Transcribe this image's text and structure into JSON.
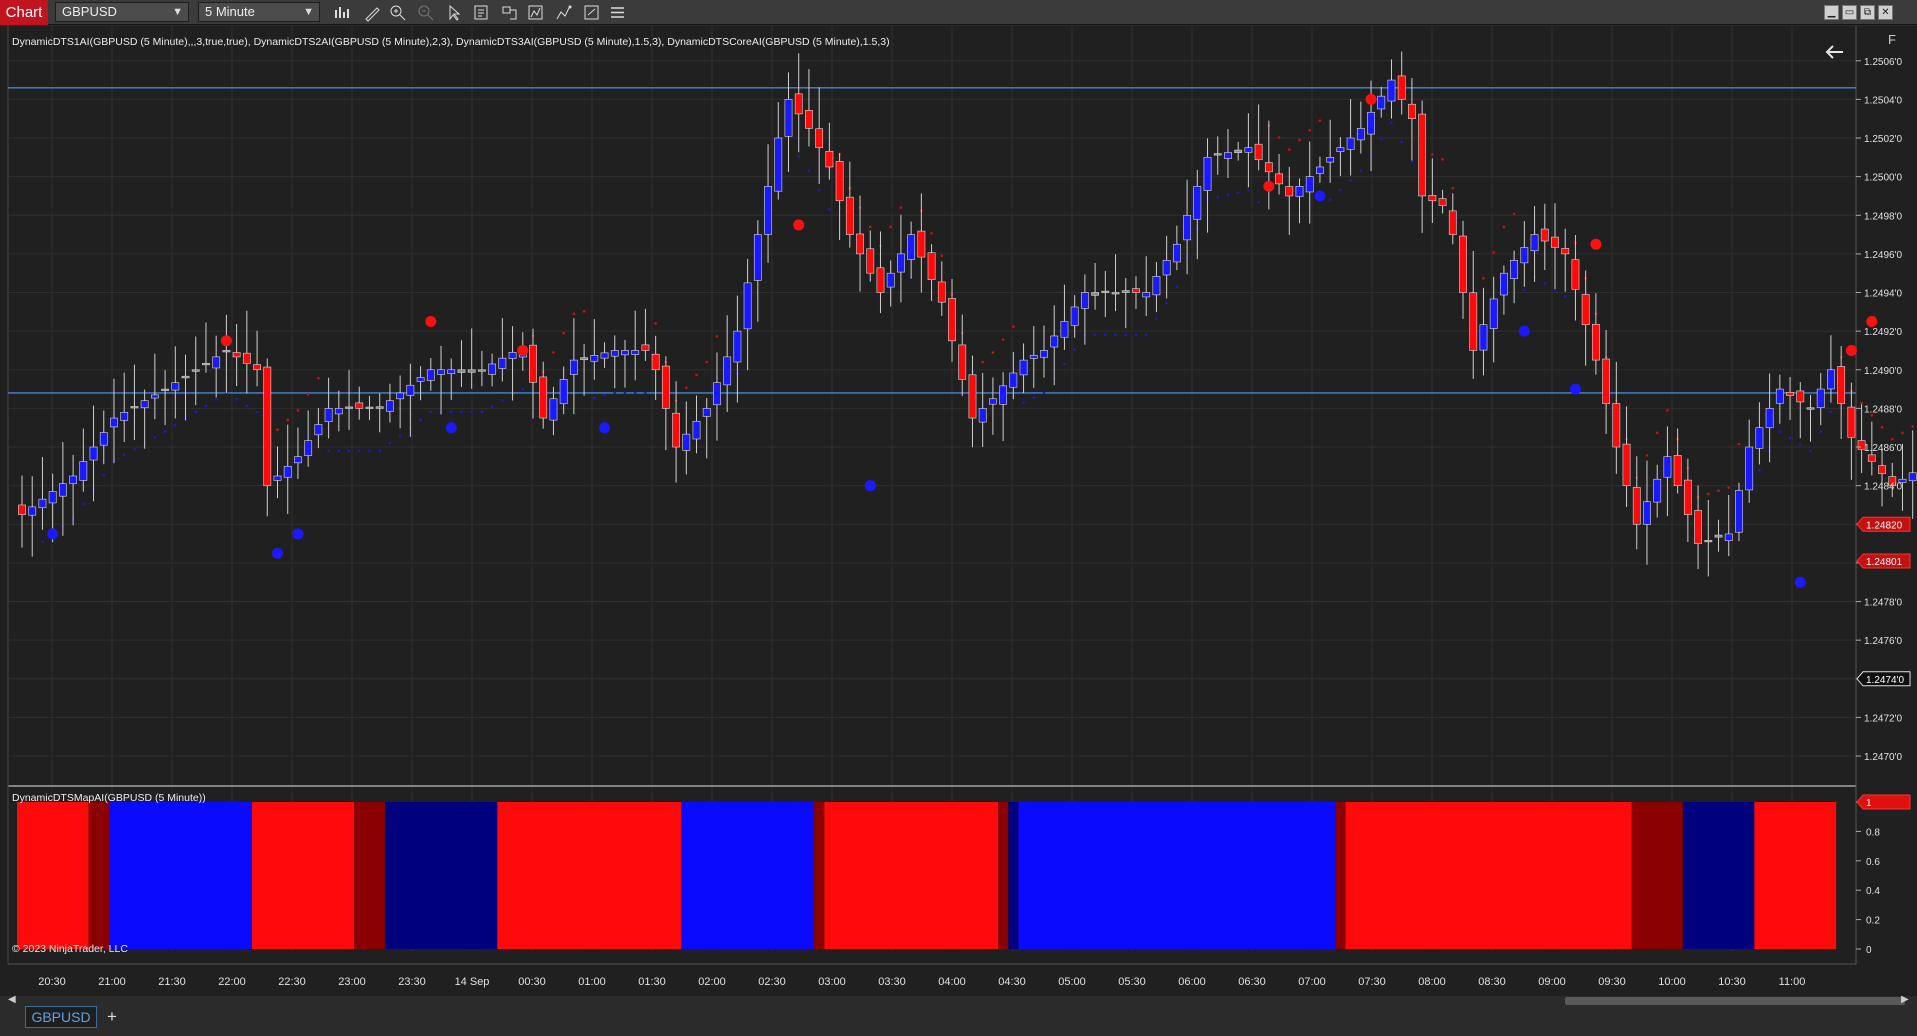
{
  "toolbar": {
    "tab_label": "Chart",
    "instrument": "GBPUSD",
    "interval": "5 Minute",
    "icons": [
      "bar-type-icon",
      "pencil-icon",
      "zoom-in-icon",
      "zoom-out-icon",
      "pointer-icon",
      "data-box-icon",
      "strategies-icon",
      "indicators-icon",
      "drawing-tools-icon",
      "properties-icon",
      "list-icon"
    ],
    "window_buttons": [
      "▁",
      "▭",
      "⧉",
      "✕"
    ]
  },
  "chart": {
    "indicator_label": "DynamicDTS1AI(GBPUSD (5 Minute),,,3,true,true), DynamicDTS2AI(GBPUSD (5 Minute),2,3), DynamicDTS3AI(GBPUSD (5 Minute),1.5,3), DynamicDTSCoreAI(GBPUSD (5 Minute),1.5,3)",
    "sub_panel_label": "DynamicDTSMapAI(GBPUSD (5 Minute))",
    "copyright": "© 2023 NinjaTrader, LLC",
    "f_button": "F",
    "colors": {
      "bull": "#1a1aff",
      "bear": "#ff0a0a",
      "neutral": "#8c8c8c",
      "line": "#4a82d6",
      "darkred": "#8b0000",
      "navy": "#00007f"
    }
  },
  "chart_data": {
    "type": "candlestick",
    "instrument": "GBPUSD",
    "interval": "5 Minute",
    "price_axis": [
      "1.2506'0",
      "1.2504'0",
      "1.2502'0",
      "1.2500'0",
      "1.2498'0",
      "1.2496'0",
      "1.2494'0",
      "1.2492'0",
      "1.2490'0",
      "1.2488'0",
      "1.2486'0",
      "1.2484'0",
      "1.2482'0",
      "1.2480'0",
      "1.2478'0",
      "1.2476'0",
      "1.2474'0",
      "1.2472'0",
      "1.2470'0"
    ],
    "price_values": [
      1.2506,
      1.2504,
      1.2502,
      1.25,
      1.2498,
      1.2496,
      1.2494,
      1.2492,
      1.249,
      1.2488,
      1.2486,
      1.2484,
      1.2482,
      1.248,
      1.2478,
      1.2476,
      1.2474,
      1.2472,
      1.247
    ],
    "ylim": [
      1.24685,
      1.25078
    ],
    "price_markers": [
      {
        "label": "1.24820",
        "value": 1.2482,
        "style": "filled-red"
      },
      {
        "label": "1.24801",
        "value": 1.24801,
        "style": "filled-red"
      },
      {
        "label": "1.2474'0",
        "value": 1.2474,
        "style": "outline"
      }
    ],
    "horizontal_lines": [
      1.25046,
      1.24888
    ],
    "time_axis": [
      "20:30",
      "21:00",
      "21:30",
      "22:00",
      "22:30",
      "23:00",
      "23:30",
      "14 Sep",
      "00:30",
      "01:00",
      "01:30",
      "02:00",
      "02:30",
      "03:00",
      "03:30",
      "04:00",
      "04:30",
      "05:00",
      "05:30",
      "06:00",
      "06:30",
      "07:00",
      "07:30",
      "08:00",
      "08:30",
      "09:00",
      "09:30",
      "10:00",
      "10:30",
      "11:00"
    ],
    "close_path": [
      [
        0,
        1.24825
      ],
      [
        5,
        1.24845
      ],
      [
        9,
        1.24875
      ],
      [
        14,
        1.2489
      ],
      [
        20,
        1.2491
      ],
      [
        23,
        1.249
      ],
      [
        24,
        1.2484
      ],
      [
        27,
        1.24855
      ],
      [
        30,
        1.2488
      ],
      [
        35,
        1.2488
      ],
      [
        40,
        1.249
      ],
      [
        45,
        1.249
      ],
      [
        49,
        1.24912
      ],
      [
        51,
        1.24875
      ],
      [
        54,
        1.24905
      ],
      [
        58,
        1.2491
      ],
      [
        61,
        1.2491
      ],
      [
        62,
        1.249
      ],
      [
        64,
        1.2486
      ],
      [
        67,
        1.2488
      ],
      [
        70,
        1.2492
      ],
      [
        72,
        1.2497
      ],
      [
        74,
        1.2502
      ],
      [
        75,
        1.2504
      ],
      [
        77,
        1.25025
      ],
      [
        79,
        1.25005
      ],
      [
        81,
        1.2497
      ],
      [
        84,
        1.2494
      ],
      [
        87,
        1.2497
      ],
      [
        90,
        1.24935
      ],
      [
        93,
        1.24875
      ],
      [
        95,
        1.24885
      ],
      [
        98,
        1.24905
      ],
      [
        100,
        1.2491
      ],
      [
        104,
        1.2494
      ],
      [
        110,
        1.2494
      ],
      [
        113,
        1.24965
      ],
      [
        116,
        1.2501
      ],
      [
        120,
        1.25015
      ],
      [
        124,
        1.2499
      ],
      [
        128,
        1.2501
      ],
      [
        131,
        1.25025
      ],
      [
        134,
        1.2505
      ],
      [
        136,
        1.2503
      ],
      [
        137,
        1.2499
      ],
      [
        139,
        1.24985
      ],
      [
        140,
        1.2497
      ],
      [
        142,
        1.2491
      ],
      [
        145,
        1.2495
      ],
      [
        148,
        1.2497
      ],
      [
        151,
        1.2496
      ],
      [
        154,
        1.24905
      ],
      [
        156,
        1.2486
      ],
      [
        158,
        1.2482
      ],
      [
        161,
        1.24855
      ],
      [
        164,
        1.2481
      ],
      [
        167,
        1.24815
      ],
      [
        169,
        1.2486
      ],
      [
        172,
        1.2489
      ],
      [
        175,
        1.2488
      ],
      [
        177,
        1.249
      ],
      [
        179,
        1.24865
      ],
      [
        183,
        1.2484
      ],
      [
        186,
        1.2485
      ],
      [
        188,
        1.2482
      ],
      [
        191,
        1.2479
      ],
      [
        193,
        1.2476
      ],
      [
        194,
        1.2474
      ]
    ],
    "signal_dots_red": [
      [
        20,
        1.24915
      ],
      [
        40,
        1.24925
      ],
      [
        49,
        1.2491
      ],
      [
        76,
        1.24975
      ],
      [
        122,
        1.24995
      ],
      [
        132,
        1.2504
      ],
      [
        154,
        1.24965
      ],
      [
        179,
        1.2491
      ],
      [
        181,
        1.24925
      ]
    ],
    "signal_dots_blue": [
      [
        3,
        1.24815
      ],
      [
        25,
        1.24805
      ],
      [
        27,
        1.24815
      ],
      [
        42,
        1.2487
      ],
      [
        57,
        1.2487
      ],
      [
        83,
        1.2484
      ],
      [
        127,
        1.2499
      ],
      [
        147,
        1.2492
      ],
      [
        152,
        1.2489
      ],
      [
        174,
        1.2479
      ]
    ],
    "sub_panel": {
      "axis": [
        "1",
        "0.8",
        "0.6",
        "0.4",
        "0.2",
        "0"
      ],
      "axis_values": [
        1,
        0.8,
        0.6,
        0.4,
        0.2,
        0
      ],
      "segments": [
        {
          "from": 0,
          "to": 7,
          "color": "#ff0a0a"
        },
        {
          "from": 7,
          "to": 9,
          "color": "#8b0000"
        },
        {
          "from": 9,
          "to": 23,
          "color": "#0a0aff"
        },
        {
          "from": 23,
          "to": 33,
          "color": "#ff0a0a"
        },
        {
          "from": 33,
          "to": 36,
          "color": "#8b0000"
        },
        {
          "from": 36,
          "to": 47,
          "color": "#00007f"
        },
        {
          "from": 47,
          "to": 65,
          "color": "#ff0a0a"
        },
        {
          "from": 65,
          "to": 78,
          "color": "#0a0aff"
        },
        {
          "from": 78,
          "to": 79,
          "color": "#8b0000"
        },
        {
          "from": 79,
          "to": 96,
          "color": "#ff0a0a"
        },
        {
          "from": 96,
          "to": 97,
          "color": "#8b0000"
        },
        {
          "from": 97,
          "to": 98,
          "color": "#00007f"
        },
        {
          "from": 98,
          "to": 129,
          "color": "#0a0aff"
        },
        {
          "from": 129,
          "to": 130,
          "color": "#8b0000"
        },
        {
          "from": 130,
          "to": 158,
          "color": "#ff0a0a"
        },
        {
          "from": 158,
          "to": 163,
          "color": "#8b0000"
        },
        {
          "from": 163,
          "to": 170,
          "color": "#00007f"
        },
        {
          "from": 170,
          "to": 178,
          "color": "#ff0a0a"
        }
      ]
    }
  },
  "bottom": {
    "tab_label": "GBPUSD",
    "add_tab": "+"
  }
}
